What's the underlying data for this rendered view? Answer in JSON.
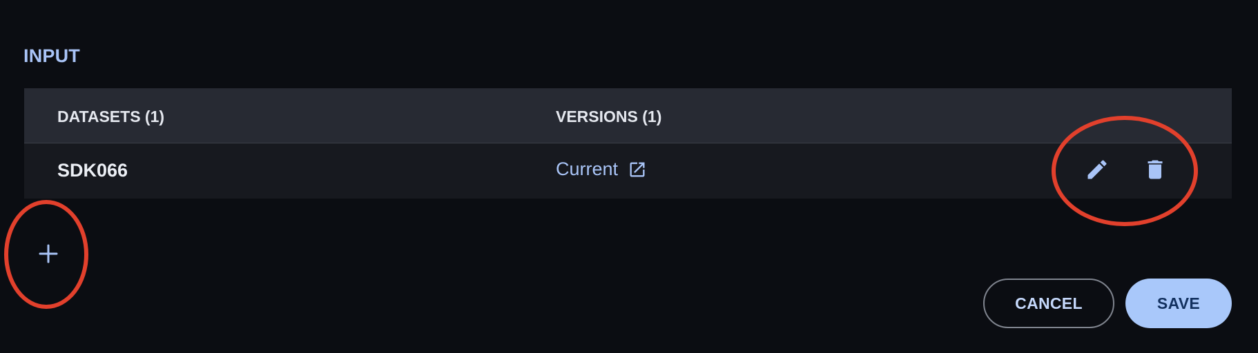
{
  "section": {
    "title": "INPUT"
  },
  "table": {
    "headers": {
      "datasets": "DATASETS (1)",
      "versions": "VERSIONS (1)"
    },
    "rows": [
      {
        "dataset": "SDK066",
        "version": "Current",
        "version_icon": "open-in-new-icon",
        "actions": [
          "edit-icon",
          "delete-icon"
        ]
      }
    ]
  },
  "add": {
    "label": "+",
    "icon": "add-icon"
  },
  "buttons": {
    "cancel": "CANCEL",
    "save": "SAVE"
  },
  "colors": {
    "background": "#0b0d12",
    "accent": "#a9c4f7",
    "annotation": "#e2402c",
    "save_button": "#a9c8fa"
  }
}
